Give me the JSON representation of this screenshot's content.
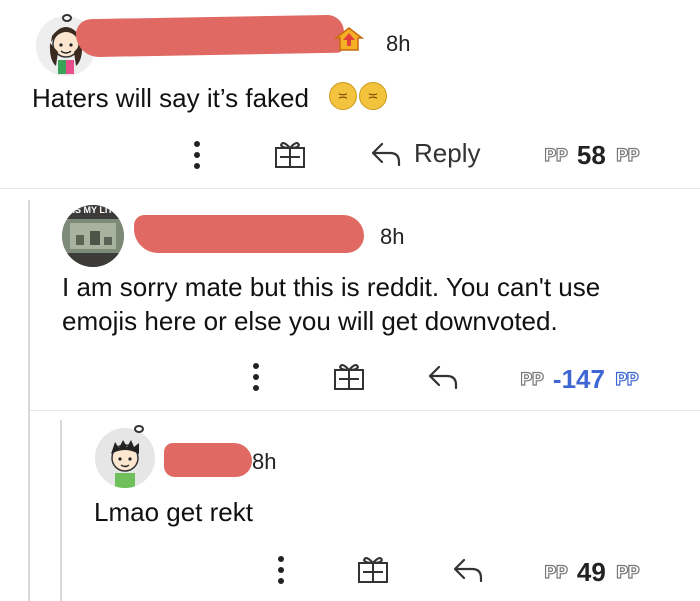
{
  "comments": [
    {
      "time": "8h",
      "body": "Haters will say it’s faked",
      "reply_label": "Reply",
      "vote_left": "PP",
      "score": "58",
      "vote_right": "PP"
    },
    {
      "time": "8h",
      "avatar_text": "S IS MY LIT",
      "body_line1": "I am sorry mate but this is reddit. You can't use",
      "body_line2": "emojis here or else you will get downvoted.",
      "vote_left": "PP",
      "score": "-147",
      "vote_right": "PP"
    },
    {
      "time": "8h",
      "body": "Lmao get rekt",
      "vote_left": "PP",
      "score": "49",
      "vote_right": "PP"
    }
  ],
  "emoji_glyph": "≍",
  "icons": {
    "more": "more-vertical-icon",
    "gift": "gift-icon",
    "reply": "reply-arrow-icon",
    "emoji": "persevering-face-emoji"
  },
  "colors": {
    "redaction": "#e06a63",
    "downvote_score": "#3f67d3"
  }
}
